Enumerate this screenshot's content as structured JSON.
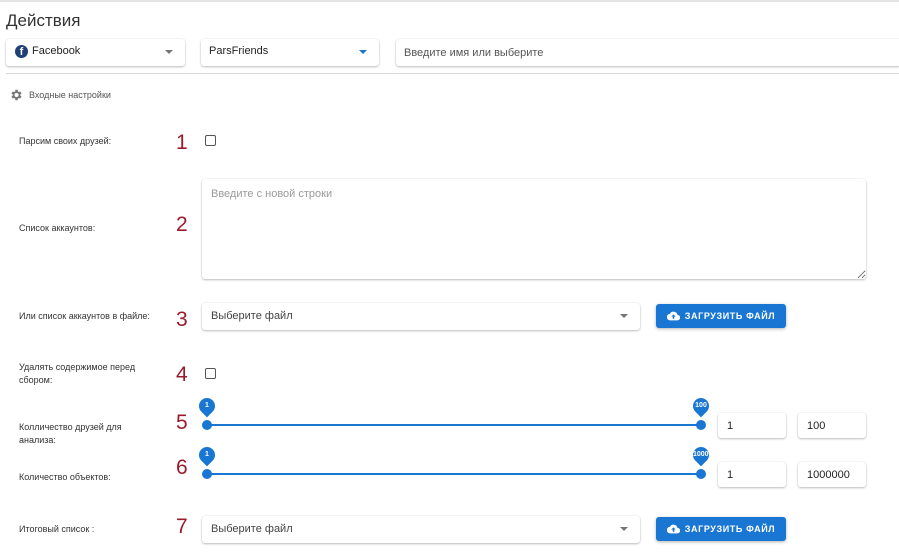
{
  "header": {
    "title": "Действия"
  },
  "selectors": {
    "network": {
      "value": "Facebook",
      "icon": "facebook-icon"
    },
    "action": {
      "value": "ParsFriends"
    },
    "account": {
      "placeholder": "Введите имя или выберите"
    }
  },
  "section": {
    "title": "Входные настройки",
    "icon": "gear-icon"
  },
  "fields": {
    "parse_own": {
      "label": "Парсим своих друзей:",
      "number": "1",
      "checked": false
    },
    "accounts_list": {
      "label": "Список аккаунтов:",
      "number": "2",
      "placeholder": "Введите с новой строки"
    },
    "accounts_file": {
      "label": "Или список аккаунтов в файле:",
      "number": "3",
      "select_value": "Выберите файл",
      "button": "ЗАГРУЗИТЬ ФАЙЛ"
    },
    "clear_before": {
      "label": "Удалять содержимое перед сбором:",
      "number": "4",
      "checked": false
    },
    "friends_count": {
      "label": "Колличество друзей для анализа:",
      "number": "5",
      "min": 1,
      "max": 100,
      "pin_min": "1",
      "pin_max": "100",
      "input_min": "1",
      "input_max": "100"
    },
    "objects_count": {
      "label": "Количество объектов:",
      "number": "6",
      "min": 1,
      "max": 1000000,
      "pin_min": "1",
      "pin_max": "10000",
      "input_min": "1",
      "input_max": "1000000"
    },
    "result_list": {
      "label": "Итоговый список :",
      "number": "7",
      "select_value": "Выберите файл",
      "button": "ЗАГРУЗИТЬ ФАЙЛ"
    }
  },
  "colors": {
    "accent": "#1976d2",
    "annotation": "#9b1b2d"
  }
}
